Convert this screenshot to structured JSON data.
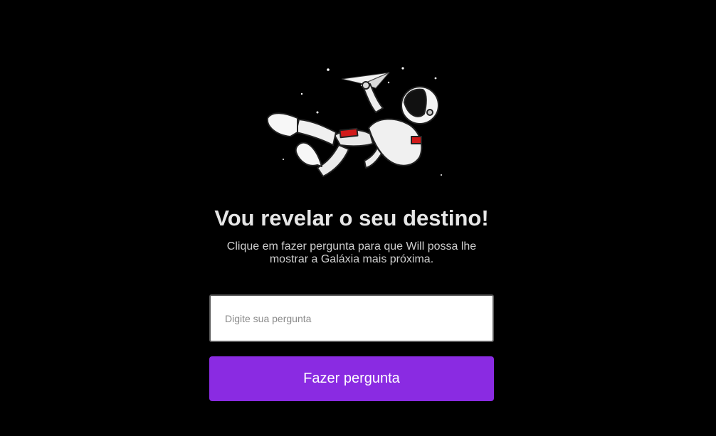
{
  "hero": {
    "icon": "astronaut-illustration"
  },
  "heading": {
    "title": "Vou revelar o seu destino!",
    "subtitle": "Clique em fazer pergunta para que Will possa lhe mostrar a Galáxia mais próxima."
  },
  "form": {
    "input_placeholder": "Digite sua pergunta",
    "input_value": "",
    "button_label": "Fazer pergunta"
  },
  "colors": {
    "background": "#000000",
    "accent": "#8a2be2",
    "title": "#e6e6e6"
  }
}
